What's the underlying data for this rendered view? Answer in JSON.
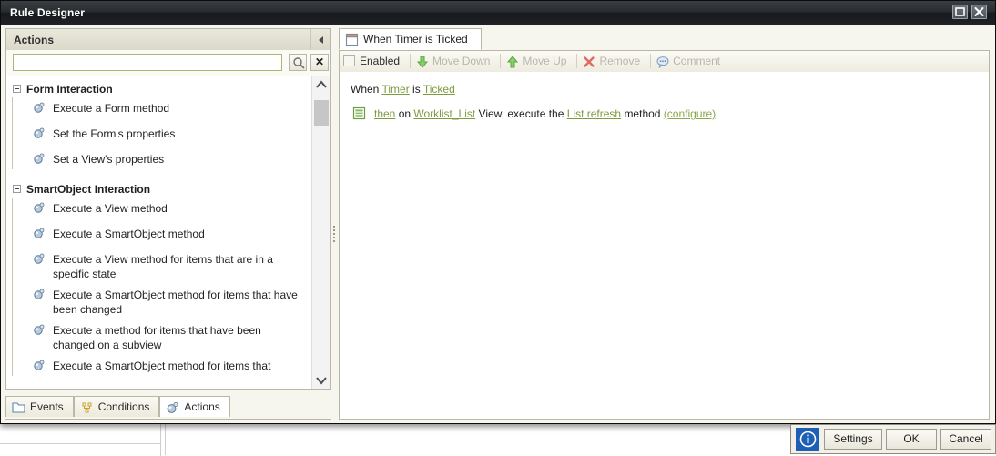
{
  "window": {
    "title": "Rule Designer",
    "maximize_icon": "maximize-icon",
    "close_icon": "close-icon"
  },
  "left_panel": {
    "header_title": "Actions",
    "collapse_icon": "chevron-left-icon",
    "search": {
      "value": "",
      "placeholder": "",
      "go_icon": "search-icon",
      "clear_label": "✕"
    },
    "scrollbar": {
      "up_icon": "chevron-up-icon",
      "down_icon": "chevron-down-icon"
    },
    "groups": [
      {
        "title": "Form Interaction",
        "expander": "collapse-toggle",
        "items": [
          "Execute a Form method",
          "Set the Form's properties",
          "Set a View's properties"
        ]
      },
      {
        "title": "SmartObject Interaction",
        "expander": "collapse-toggle",
        "items": [
          "Execute a View method",
          "Execute a SmartObject method",
          "Execute a View method for items that are in a specific state",
          "Execute a SmartObject method for items that have been changed",
          "Execute a method for items that have been changed on a subview",
          "Execute a SmartObject method for items that"
        ]
      }
    ],
    "tabs": [
      {
        "label": "Events",
        "icon": "folder-icon",
        "active": false
      },
      {
        "label": "Conditions",
        "icon": "condition-icon",
        "active": false
      },
      {
        "label": "Actions",
        "icon": "action-gear-icon",
        "active": true
      }
    ]
  },
  "right_panel": {
    "tab": {
      "label": "When Timer is Ticked",
      "icon": "rule-window-icon"
    },
    "toolbar": {
      "enabled_label": "Enabled",
      "enabled_checked": false,
      "items": [
        {
          "label": "Move Down",
          "icon": "arrow-down-icon",
          "disabled": true
        },
        {
          "label": "Move Up",
          "icon": "arrow-up-icon",
          "disabled": true
        },
        {
          "label": "Remove",
          "icon": "remove-x-icon",
          "disabled": true
        },
        {
          "label": "Comment",
          "icon": "comment-bubble-icon",
          "disabled": true
        }
      ]
    },
    "rule": {
      "line1": {
        "when": "When",
        "subject": "Timer",
        "is": "is",
        "event": "Ticked"
      },
      "line2": {
        "icon": "list-view-icon",
        "then": "then",
        "on": "on",
        "view": "Worklist_List",
        "view_word": "View, execute the",
        "method": "List refresh",
        "method_word": "method",
        "configure": "(configure)"
      }
    }
  },
  "bottom_bar": {
    "info_icon": "info-icon",
    "settings_label": "Settings",
    "ok_label": "OK",
    "cancel_label": "Cancel"
  }
}
